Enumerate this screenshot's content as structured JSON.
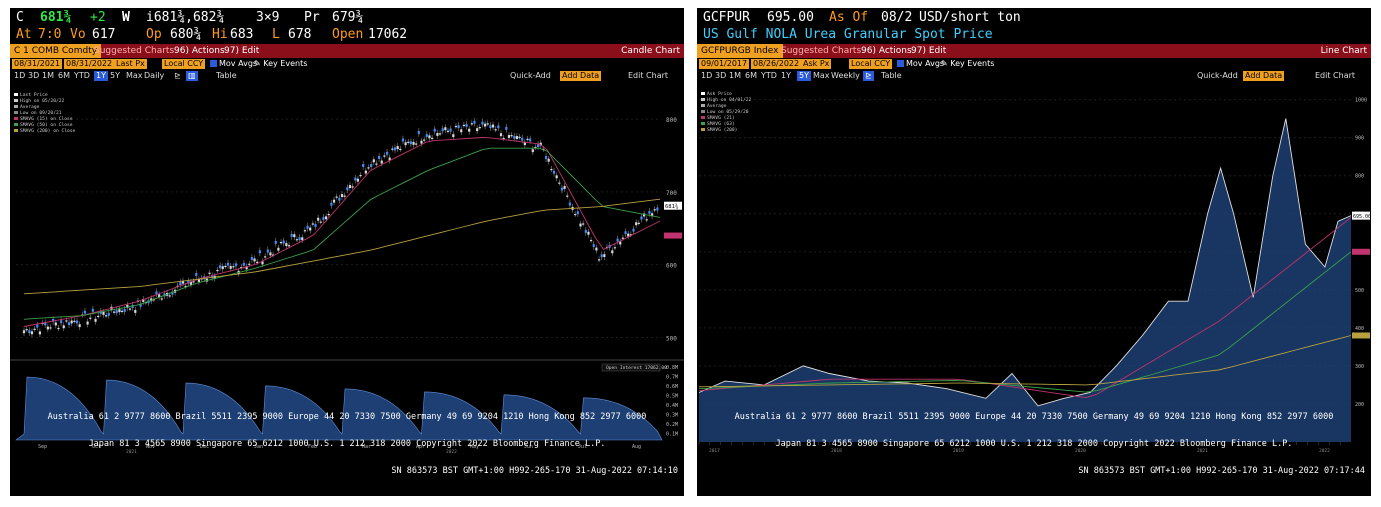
{
  "left": {
    "header1": {
      "ticker": "C",
      "last": "681¾",
      "chg": "+2",
      "pbox": "i681¾,682¾",
      "qty": "3×9",
      "pr_label": "Pr",
      "pr": "679¾"
    },
    "header2": {
      "at_label": "At",
      "at": "7:0",
      "vo_label": "Vo",
      "vo": "617",
      "op_label": "Op",
      "op": "680¾",
      "hi_label": "Hi",
      "hi": "683",
      "lo_label": "L",
      "lo": "678",
      "open_label": "Open",
      "open": "17062"
    },
    "security": "C 1 COMB Comdty",
    "suggested": "Suggested Charts",
    "actions": "96) Actions",
    "edit": "97) Edit",
    "chart_kind": "Candle Chart",
    "date_from": "08/31/2021",
    "date_to": "08/31/2022",
    "field": "Last Px",
    "currency": "Local CCY",
    "mov_avgs": "Mov Avgs",
    "key_events": "Key Events",
    "periods": [
      "1D",
      "3D",
      "1M",
      "6M",
      "YTD",
      "1Y",
      "5Y",
      "Max"
    ],
    "period_selected": "1Y",
    "freq": "Daily",
    "table_label": "Table",
    "quick_add": "Quick-Add",
    "add_data": "Add Data",
    "edit_chart": "Edit Chart",
    "legend": [
      "Last Price",
      "High on 05/20/22",
      "Average",
      "Low on 09/20/21",
      "SMAVG (15) on Close",
      "SMAVG (50) on Close",
      "SMAVG (200) on Close"
    ],
    "oi_label": "Open Interest 17062.00",
    "x_months": [
      "Sep",
      "Oct",
      "Nov",
      "Dec",
      "Jan",
      "Feb",
      "Mar",
      "Apr",
      "May",
      "Jun",
      "Jul",
      "Aug"
    ],
    "x_years": [
      "2021",
      "2022"
    ],
    "y_ticks": [
      "800",
      "700",
      "600",
      "500"
    ],
    "oi_ticks": [
      "0.8M",
      "0.7M",
      "0.6M",
      "0.5M",
      "0.4M",
      "0.3M",
      "0.2M",
      "0.1M"
    ],
    "price_tag": "681¾",
    "ma_tag": "",
    "footer1": "Australia 61 2 9777 8600 Brazil 5511 2395 9000 Europe 44 20 7330 7500 Germany 49 69 9204 1210 Hong Kong 852 2977 6000",
    "footer2": "Japan 81 3 4565 8900        Singapore 65 6212 1000        U.S. 1 212 318 2000           Copyright 2022 Bloomberg Finance L.P.",
    "footer3": "SN 863573 BST  GMT+1:00 H992-265-170 31-Aug-2022 07:14:10"
  },
  "right": {
    "header1": {
      "ticker": "GCFPUR",
      "price": "695.00",
      "asof_label": "As Of",
      "asof": "08/2",
      "unit": "USD/short ton"
    },
    "header2": {
      "desc": "US Gulf NOLA Urea Granular Spot Price"
    },
    "security": "GCFPURGB Index",
    "suggested": "Suggested Charts",
    "actions": "96) Actions",
    "edit": "97) Edit",
    "chart_kind": "Line Chart",
    "date_from": "09/01/2017",
    "date_to": "08/26/2022",
    "field": "Ask Px",
    "currency": "Local CCY",
    "mov_avgs": "Mov Avgs",
    "key_events": "Key Events",
    "periods": [
      "1D",
      "3D",
      "1M",
      "6M",
      "YTD",
      "1Y",
      "5Y",
      "Max"
    ],
    "period_selected": "5Y",
    "freq": "Weekly",
    "table_label": "Table",
    "quick_add": "Quick-Add",
    "add_data": "Add Data",
    "edit_chart": "Edit Chart",
    "legend": [
      "Ask Price",
      "High on 04/01/22",
      "Average",
      "Low on 05/29/20",
      "SMAVG (21)",
      "SMAVG (63)",
      "SMAVG (200)"
    ],
    "x_years": [
      "2017",
      "2018",
      "2019",
      "2020",
      "2021",
      "2022"
    ],
    "y_ticks": [
      "1000",
      "900",
      "800",
      "700",
      "600",
      "500",
      "400",
      "300",
      "200"
    ],
    "price_tag": "695.00",
    "footer1": "Australia 61 2 9777 8600 Brazil 5511 2395 9000 Europe 44 20 7330 7500 Germany 49 69 9204 1210 Hong Kong 852 2977 6000",
    "footer2": "Japan 81 3 4565 8900        Singapore 65 6212 1000        U.S. 1 212 318 2000           Copyright 2022 Bloomberg Finance L.P.",
    "footer3": "SN 863573 BST  GMT+1:00 H992-265-170 31-Aug-2022 07:17:44"
  },
  "colors": {
    "accent_red": "#8a0f1a",
    "orange": "#f0a020",
    "green": "#2ee84a",
    "cyan": "#3fd0ff",
    "area": "#1d3f73",
    "sma_short": "#c0336d",
    "sma_mid": "#3aa04a",
    "sma_long": "#b8a040"
  },
  "chart_data": [
    {
      "type": "line",
      "title": "C 1 COMB Comdty",
      "ylabel": "",
      "ylim": [
        480,
        840
      ],
      "x": [
        "Sep",
        "Oct",
        "Nov",
        "Dec",
        "Jan",
        "Feb",
        "Mar",
        "Apr",
        "May",
        "Jun",
        "Jul",
        "Aug"
      ],
      "series": [
        {
          "name": "Last Price",
          "values": [
            510,
            525,
            545,
            580,
            605,
            650,
            740,
            780,
            790,
            760,
            610,
            681
          ]
        },
        {
          "name": "SMAVG (15) on Close",
          "values": [
            515,
            530,
            550,
            580,
            600,
            640,
            730,
            770,
            775,
            765,
            620,
            660
          ]
        },
        {
          "name": "SMAVG (50) on Close",
          "values": [
            525,
            530,
            545,
            575,
            595,
            620,
            690,
            730,
            760,
            760,
            680,
            665
          ]
        },
        {
          "name": "SMAVG (200) on Close",
          "values": [
            560,
            565,
            570,
            580,
            590,
            605,
            620,
            640,
            660,
            675,
            680,
            690
          ]
        }
      ]
    },
    {
      "type": "area",
      "title": "GCFPURGB Index",
      "ylabel": "USD/short ton",
      "ylim": [
        100,
        1020
      ],
      "x": [
        "2017",
        "2018",
        "2019",
        "2020",
        "2021",
        "2022"
      ],
      "series": [
        {
          "name": "Ask Price",
          "values": [
            230,
            270,
            270,
            200,
            480,
            695
          ]
        },
        {
          "name": "SMAVG (21)",
          "values": [
            235,
            265,
            265,
            215,
            420,
            690
          ]
        },
        {
          "name": "SMAVG (63)",
          "values": [
            240,
            255,
            262,
            230,
            330,
            600
          ]
        },
        {
          "name": "SMAVG (200)",
          "values": [
            245,
            250,
            255,
            250,
            290,
            380
          ]
        }
      ]
    }
  ]
}
